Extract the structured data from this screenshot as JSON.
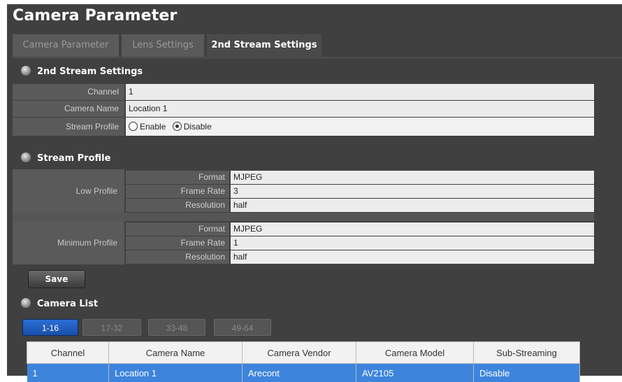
{
  "page": {
    "title": "Camera Parameter"
  },
  "tabs": [
    {
      "label": "Camera Parameter",
      "active": false
    },
    {
      "label": "Lens Settings",
      "active": false
    },
    {
      "label": "2nd Stream Settings",
      "active": true
    }
  ],
  "second_stream": {
    "heading": "2nd Stream Settings",
    "channel_label": "Channel",
    "channel_value": "1",
    "camera_name_label": "Camera Name",
    "camera_name_value": "Location 1",
    "stream_profile_label": "Stream Profile",
    "enable_label": "Enable",
    "disable_label": "Disable",
    "selected": "Disable"
  },
  "stream_profile": {
    "heading": "Stream Profile",
    "low": {
      "label": "Low Profile",
      "format_label": "Format",
      "format_value": "MJPEG",
      "frame_rate_label": "Frame Rate",
      "frame_rate_value": "3",
      "resolution_label": "Resolution",
      "resolution_value": "half"
    },
    "minimum": {
      "label": "Minimum Profile",
      "format_label": "Format",
      "format_value": "MJPEG",
      "frame_rate_label": "Frame Rate",
      "frame_rate_value": "1",
      "resolution_label": "Resolution",
      "resolution_value": "half"
    }
  },
  "save_label": "Save",
  "camera_list": {
    "heading": "Camera List",
    "pages": [
      {
        "label": "1-16",
        "active": true
      },
      {
        "label": "17-32",
        "active": false
      },
      {
        "label": "33-48",
        "active": false
      },
      {
        "label": "49-64",
        "active": false
      }
    ],
    "columns": [
      "Channel",
      "Camera Name",
      "Camera Vendor",
      "Camera Model",
      "Sub-Streaming"
    ],
    "rows": [
      [
        "1",
        "Location 1",
        "Arecont",
        "AV2105",
        "Disable"
      ]
    ]
  },
  "colors": {
    "selected_row": "#3d84dd",
    "active_page": "#1f5fc0",
    "panel_bg": "#404040"
  }
}
